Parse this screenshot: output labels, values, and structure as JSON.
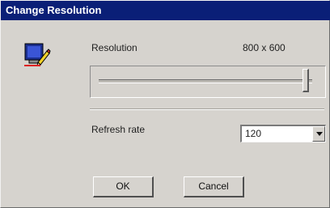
{
  "window": {
    "title": "Change Resolution"
  },
  "resolution": {
    "label": "Resolution",
    "value": "800 x 600",
    "slider_position_fraction": 0.97
  },
  "refresh": {
    "label": "Refresh rate",
    "selected": "120"
  },
  "buttons": {
    "ok": "OK",
    "cancel": "Cancel"
  },
  "icons": {
    "app_icon": "monitor-pencil-icon",
    "dropdown_arrow": "chevron-down-icon"
  },
  "colors": {
    "titlebar": "#0a1f77",
    "dialog_bg": "#d6d3ce"
  }
}
